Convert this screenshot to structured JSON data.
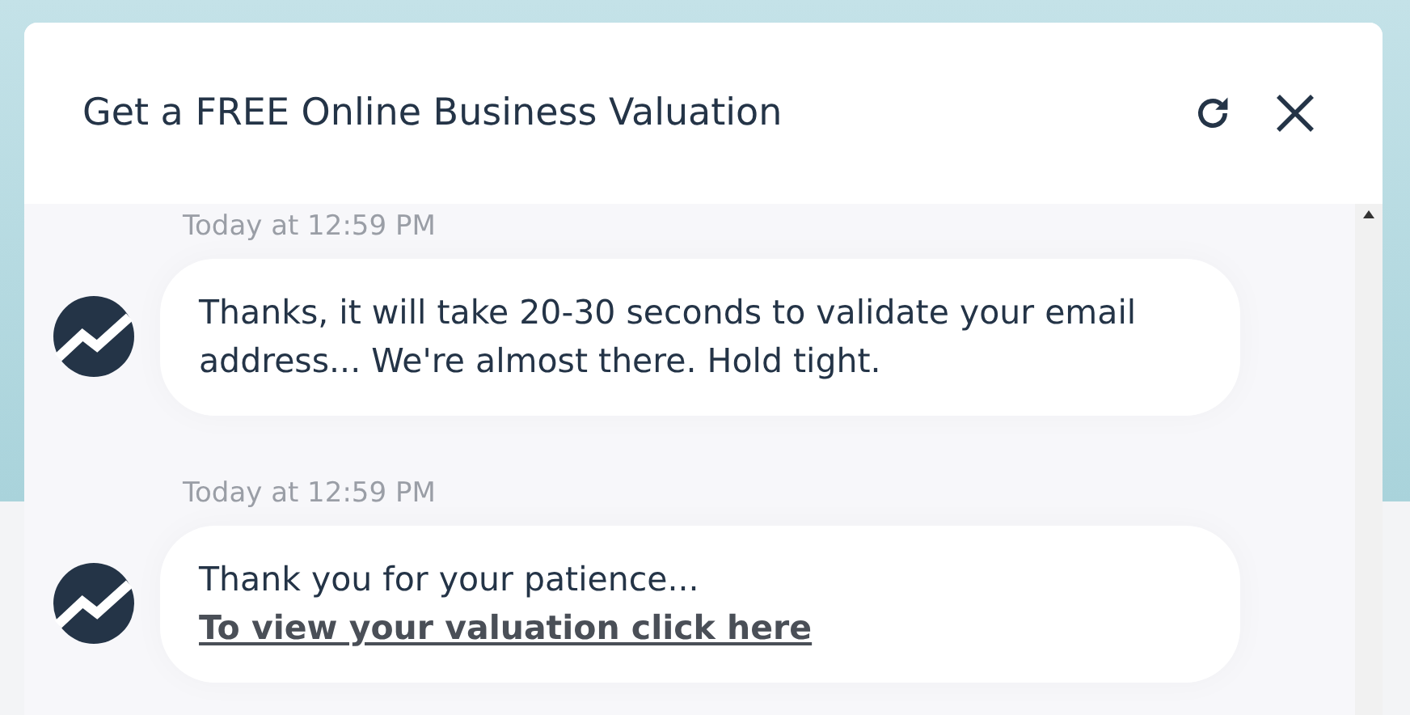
{
  "dialog": {
    "title": "Get a FREE Online Business Valuation"
  },
  "messages": [
    {
      "timestamp": "Today at 12:59 PM",
      "text": "Thanks, it will take 20-30 seconds to validate your email address... We're almost there. Hold tight."
    },
    {
      "timestamp": "Today at 12:59 PM",
      "text": "Thank you for your patience...",
      "link": "To view your valuation click here"
    }
  ]
}
